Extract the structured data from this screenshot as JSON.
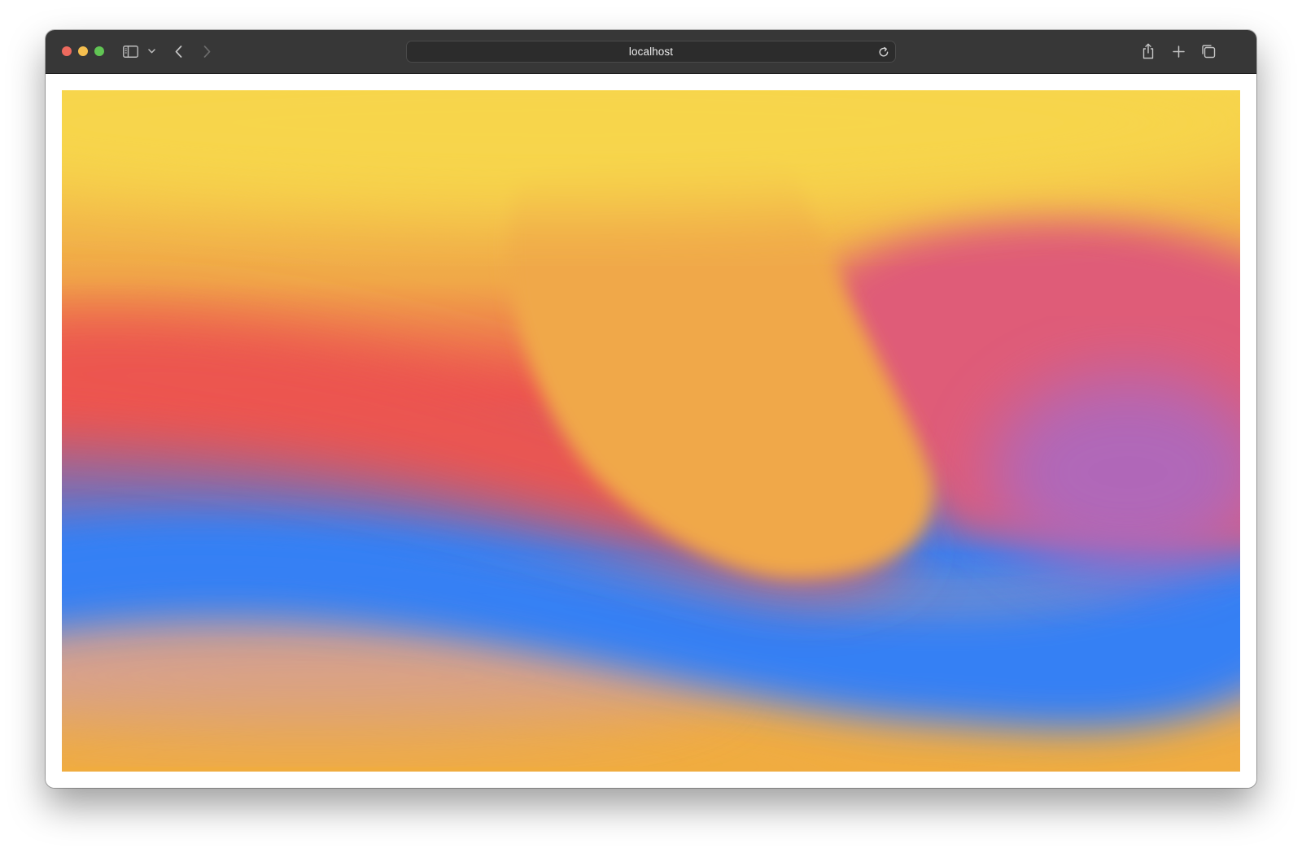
{
  "browser": {
    "url": "localhost",
    "colors": {
      "toolbar": "#373737",
      "close": "#ed6a5e",
      "minimize": "#f5bf4f",
      "maximize": "#61c554"
    },
    "icons": {
      "sidebar": "sidebar-icon",
      "chevron": "chevron-down-icon",
      "back": "back-icon",
      "forward": "forward-icon",
      "reload": "reload-icon",
      "share": "share-icon",
      "new_tab": "plus-icon",
      "tabs": "tabs-overview-icon"
    }
  },
  "gradient": {
    "colors": {
      "yellow": "#f7d54c",
      "orange": "#f0a848",
      "red": "#ec5450",
      "pink": "#df5b78",
      "purple": "#a86ac4",
      "blue": "#3480f4",
      "peach": "#d6a090",
      "bottom_orange": "#f0ac40"
    }
  }
}
